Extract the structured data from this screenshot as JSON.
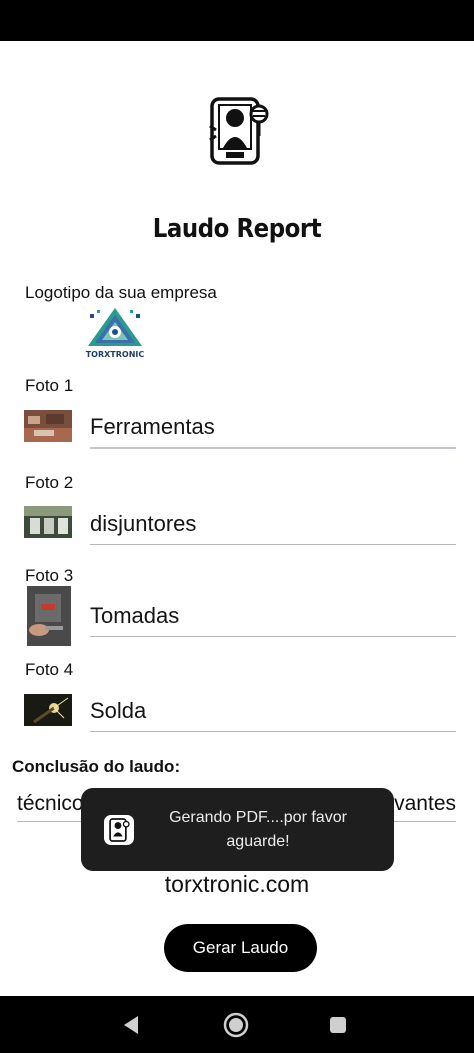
{
  "app": {
    "title": "Laudo Report",
    "logo_label": "Logotipo da sua empresa",
    "company_logo_text": "TORXTRONIC"
  },
  "photos": [
    {
      "label": "Foto 1",
      "description": "Ferramentas"
    },
    {
      "label": "Foto 2",
      "description": "disjuntores"
    },
    {
      "label": "Foto 3",
      "description": "Tomadas"
    },
    {
      "label": "Foto 4",
      "description": "Solda"
    }
  ],
  "conclusion": {
    "label": "Conclusão do laudo:",
    "value_start": "técnico",
    "value_end": "vantes"
  },
  "website": "torxtronic.com",
  "generate_button": "Gerar Laudo",
  "toast": {
    "message": "Gerando PDF....por favor aguarde!"
  },
  "navigation": {
    "back_icon": "back-icon",
    "home_icon": "home-icon",
    "recents_icon": "recents-icon"
  },
  "colors": {
    "primary": "#000000",
    "toast_bg": "#1e1e1e",
    "focused_underline": "#c9c2cf"
  }
}
